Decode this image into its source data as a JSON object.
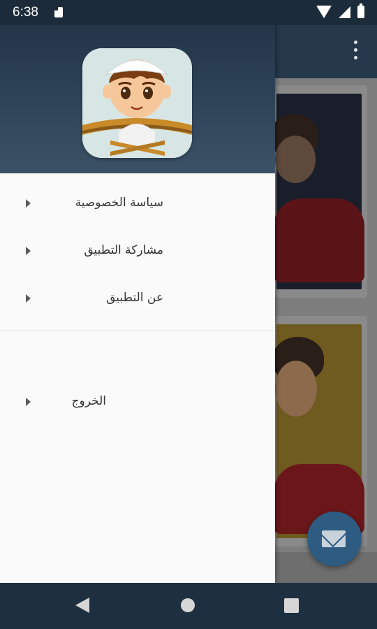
{
  "status_bar": {
    "time": "6:38"
  },
  "drawer": {
    "items": [
      {
        "label": "سياسة الخصوصية",
        "icon": "arrow-right"
      },
      {
        "label": "مشاركة التطبيق",
        "icon": "arrow-right"
      },
      {
        "label": "عن التطبيق",
        "icon": "arrow-right"
      },
      {
        "label": "الخروج",
        "icon": "arrow-right"
      }
    ]
  },
  "colors": {
    "header_dark": "#1f3043",
    "accent": "#2d5b82",
    "drawer_bg": "#fafafa"
  }
}
